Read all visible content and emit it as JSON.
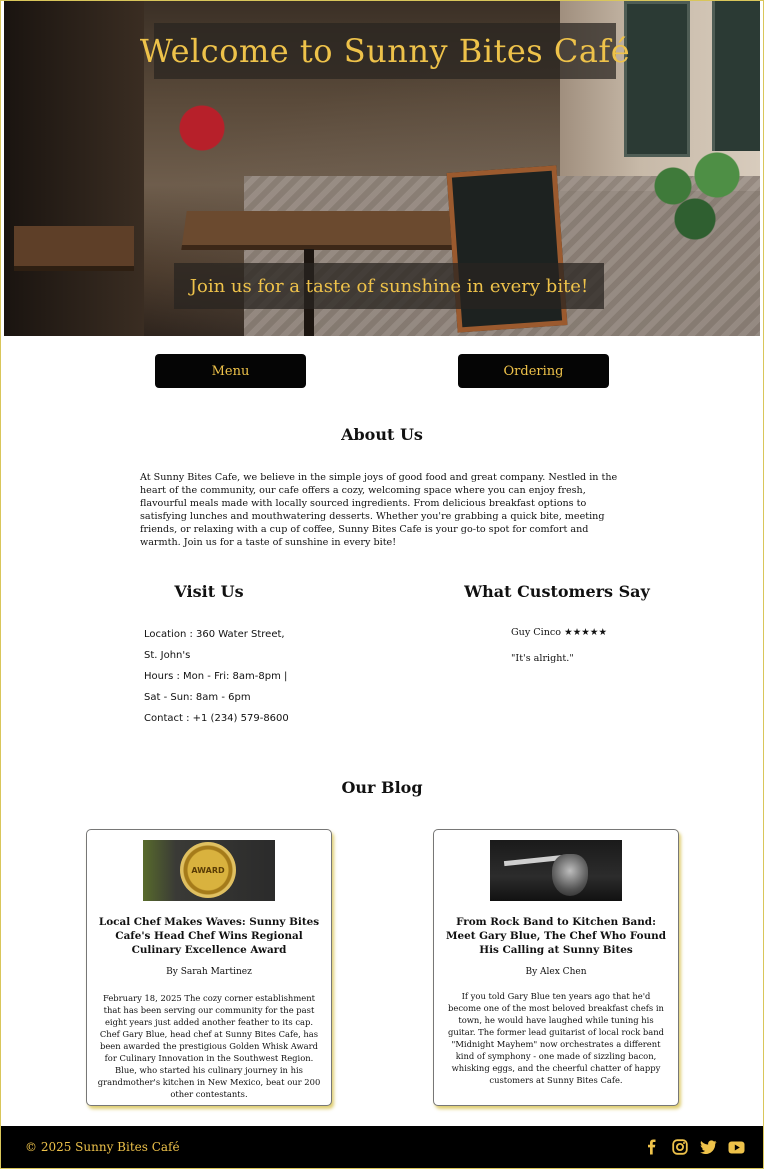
{
  "hero": {
    "title": "Welcome to Sunny Bites Café",
    "subtitle": "Join us for a taste of sunshine in every bite!"
  },
  "nav": {
    "menu_label": "Menu",
    "ordering_label": "Ordering"
  },
  "about": {
    "title": "About Us",
    "text": "At Sunny Bites Cafe, we believe in the simple joys of good food and great company. Nestled in the heart of the community, our cafe offers a cozy, welcoming space where you can enjoy fresh, flavourful meals made with locally sourced ingredients. From delicious breakfast options to satisfying lunches and mouthwatering desserts. Whether you're grabbing a quick bite, meeting friends, or relaxing with a cup of coffee, Sunny Bites Cafe is your go-to spot for comfort and warmth. Join us for a taste of sunshine in every bite!"
  },
  "visit": {
    "title": "Visit Us",
    "lines": [
      "Location : 360 Water Street,",
      "St. John's",
      "Hours : Mon - Fri: 8am-8pm |",
      "Sat - Sun: 8am - 6pm",
      "Contact : +1 (234) 579-8600"
    ]
  },
  "reviews": {
    "title": "What Customers Say",
    "name": "Guy Cinco ★★★★★",
    "text": "\"It's alright.\""
  },
  "blog": {
    "title": "Our Blog",
    "posts": [
      {
        "title": "Local Chef Makes Waves: Sunny Bites Cafe's Head Chef Wins Regional Culinary Excellence Award",
        "author": "By Sarah Martinez",
        "body": "February 18, 2025 The cozy corner establishment that has been serving our community for the past eight years just added another feather to its cap. Chef Gary Blue, head chef at Sunny Bites Cafe, has been awarded the prestigious Golden Whisk Award for Culinary Innovation in the Southwest Region. Blue, who started his culinary journey in his grandmother's kitchen in New Mexico, beat our 200 other contestants.",
        "image_text": "AWARD"
      },
      {
        "title": "From Rock Band to Kitchen Band: Meet Gary Blue, The Chef Who Found His Calling at Sunny Bites",
        "author": "By Alex Chen",
        "body": "If you told Gary Blue ten years ago that he'd become one of the most beloved breakfast chefs in town, he would have laughed while tuning his guitar. The former lead guitarist of local rock band \"Midnight Mayhem\" now orchestrates a different kind of symphony - one made of sizzling bacon, whisking eggs, and the cheerful chatter of happy customers at Sunny Bites Cafe."
      }
    ]
  },
  "footer": {
    "copyright": "© 2025 Sunny Bites Café",
    "social": [
      "facebook-icon",
      "instagram-icon",
      "twitter-icon",
      "youtube-icon"
    ]
  },
  "colors": {
    "accent": "#eec24a",
    "dark": "#050505",
    "border": "#d9c65a"
  }
}
